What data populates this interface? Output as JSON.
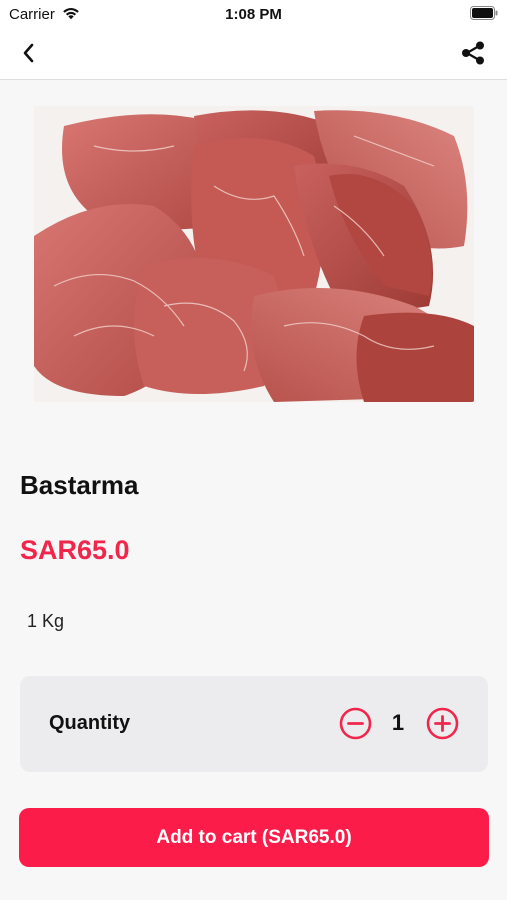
{
  "status_bar": {
    "carrier": "Carrier",
    "time": "1:08 PM"
  },
  "nav": {
    "back_icon": "chevron-left-icon",
    "share_icon": "share-icon"
  },
  "product": {
    "name": "Bastarma",
    "price": "SAR65.0",
    "size": "1 Kg",
    "image_subject": "sliced cured beef (bastarma)"
  },
  "quantity": {
    "label": "Quantity",
    "value": "1"
  },
  "cart": {
    "button_label": "Add to cart (SAR65.0)"
  },
  "colors": {
    "accent": "#fc1c4a",
    "price": "#f0264c",
    "background": "#f7f7f7",
    "card": "#ececee"
  }
}
